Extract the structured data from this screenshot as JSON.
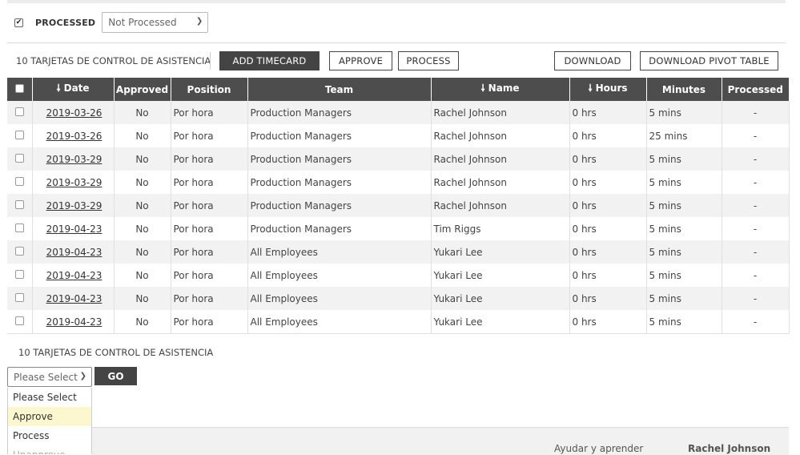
{
  "filter": {
    "processed_label": "PROCESSED",
    "processed_checked": true,
    "status_select": "Not Processed"
  },
  "toolbar": {
    "count_label": "10 TARJETAS DE CONTROL DE ASISTENCIA",
    "add_timecard": "ADD TIMECARD",
    "approve": "APPROVE",
    "process": "PROCESS",
    "download": "DOWNLOAD",
    "download_pivot": "DOWNLOAD PIVOT TABLE"
  },
  "table": {
    "headers": {
      "date": "Date",
      "approved": "Approved",
      "position": "Position",
      "team": "Team",
      "name": "Name",
      "hours": "Hours",
      "minutes": "Minutes",
      "processed": "Processed"
    },
    "sort_icon": "arrow-down-icon",
    "rows": [
      {
        "date": "2019-03-26",
        "approved": "No",
        "position": "Por hora",
        "team": "Production Managers",
        "name": "Rachel Johnson",
        "hours": "0 hrs",
        "minutes": "5 mins",
        "processed": "-"
      },
      {
        "date": "2019-03-26",
        "approved": "No",
        "position": "Por hora",
        "team": "Production Managers",
        "name": "Rachel Johnson",
        "hours": "0 hrs",
        "minutes": "25 mins",
        "processed": "-"
      },
      {
        "date": "2019-03-29",
        "approved": "No",
        "position": "Por hora",
        "team": "Production Managers",
        "name": "Rachel Johnson",
        "hours": "0 hrs",
        "minutes": "5 mins",
        "processed": "-"
      },
      {
        "date": "2019-03-29",
        "approved": "No",
        "position": "Por hora",
        "team": "Production Managers",
        "name": "Rachel Johnson",
        "hours": "0 hrs",
        "minutes": "5 mins",
        "processed": "-"
      },
      {
        "date": "2019-03-29",
        "approved": "No",
        "position": "Por hora",
        "team": "Production Managers",
        "name": "Rachel Johnson",
        "hours": "0 hrs",
        "minutes": "5 mins",
        "processed": "-"
      },
      {
        "date": "2019-04-23",
        "approved": "No",
        "position": "Por hora",
        "team": "Production Managers",
        "name": "Tim Riggs",
        "hours": "0 hrs",
        "minutes": "5 mins",
        "processed": "-"
      },
      {
        "date": "2019-04-23",
        "approved": "No",
        "position": "Por hora",
        "team": "All Employees",
        "name": "Yukari Lee",
        "hours": "0 hrs",
        "minutes": "5 mins",
        "processed": "-"
      },
      {
        "date": "2019-04-23",
        "approved": "No",
        "position": "Por hora",
        "team": "All Employees",
        "name": "Yukari Lee",
        "hours": "0 hrs",
        "minutes": "5 mins",
        "processed": "-"
      },
      {
        "date": "2019-04-23",
        "approved": "No",
        "position": "Por hora",
        "team": "All Employees",
        "name": "Yukari Lee",
        "hours": "0 hrs",
        "minutes": "5 mins",
        "processed": "-"
      },
      {
        "date": "2019-04-23",
        "approved": "No",
        "position": "Por hora",
        "team": "All Employees",
        "name": "Yukari Lee",
        "hours": "0 hrs",
        "minutes": "5 mins",
        "processed": "-"
      }
    ]
  },
  "bulk": {
    "count_label": "10 TARJETAS DE CONTROL DE ASISTENCIA",
    "select_value": "Please Select",
    "go": "GO",
    "options": [
      "Please Select",
      "Approve",
      "Process",
      "Unapprove"
    ],
    "highlighted_index": 1
  },
  "footer": {
    "help": "Ayudar y aprender",
    "user": "Rachel Johnson"
  },
  "colors": {
    "header_bg": "#4d4d4d",
    "row_alt": "#f2f2f2",
    "button_dark": "#444444",
    "option_highlight": "#fdf7cf"
  }
}
